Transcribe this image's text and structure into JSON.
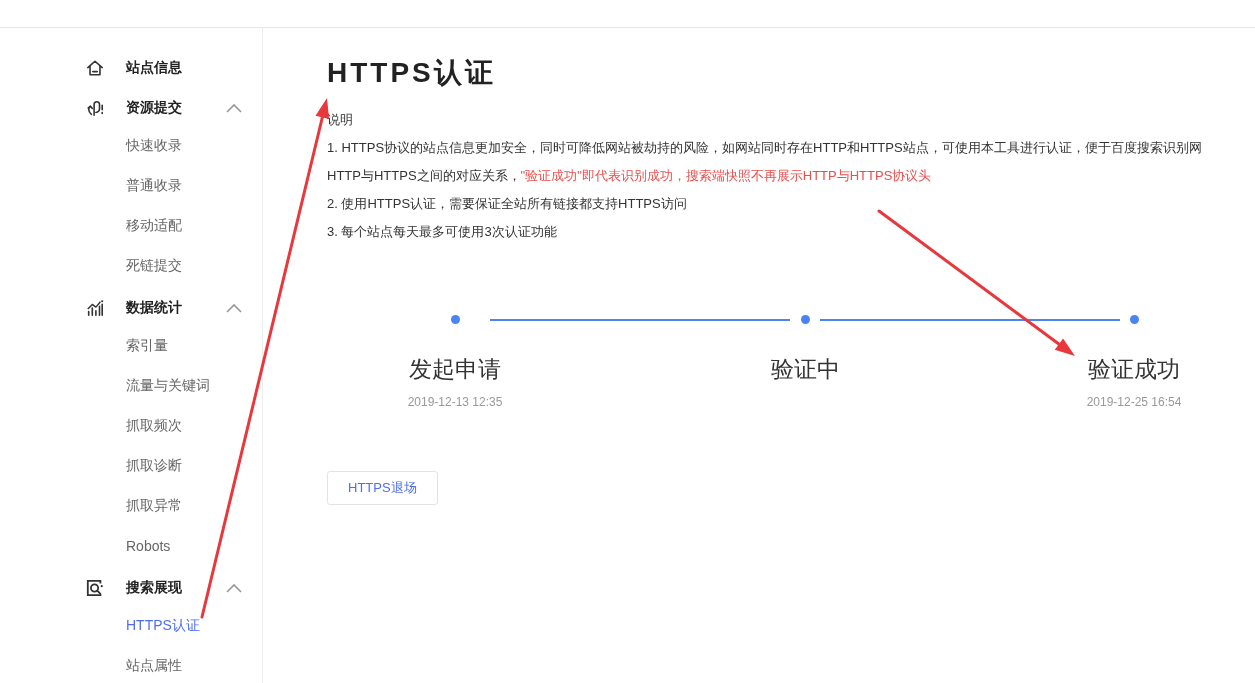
{
  "sidebar": {
    "top_item": {
      "label": "站点信息",
      "selected": false
    },
    "groups": [
      {
        "label": "资源提交",
        "expanded": true,
        "items": [
          {
            "label": "快速收录",
            "selected": false
          },
          {
            "label": "普通收录",
            "selected": false
          },
          {
            "label": "移动适配",
            "selected": false
          },
          {
            "label": "死链提交",
            "selected": false
          }
        ]
      },
      {
        "label": "数据统计",
        "expanded": true,
        "items": [
          {
            "label": "索引量",
            "selected": false
          },
          {
            "label": "流量与关键词",
            "selected": false
          },
          {
            "label": "抓取频次",
            "selected": false
          },
          {
            "label": "抓取诊断",
            "selected": false
          },
          {
            "label": "抓取异常",
            "selected": false
          },
          {
            "label": "Robots",
            "selected": false
          }
        ]
      },
      {
        "label": "搜索展现",
        "expanded": true,
        "items": [
          {
            "label": "HTTPS认证",
            "selected": true
          },
          {
            "label": "站点属性",
            "selected": false
          }
        ]
      }
    ]
  },
  "title": "HTTPS认证",
  "notes": {
    "heading": "说明",
    "lines": [
      {
        "text": "1. HTTPS协议的站点信息更加安全，同时可降低网站被劫持的风险，如网站同时存在HTTP和HTTPS站点，可使用本工具进行认证，便于百度搜索识别网"
      },
      {
        "text": "HTTP与HTTPS之间的对应关系，",
        "highlight": "\"验证成功\"即代表识别成功，搜索端快照不再展示HTTP与HTTPS协议头"
      },
      {
        "text": "2. 使用HTTPS认证，需要保证全站所有链接都支持HTTPS访问"
      },
      {
        "text": "3. 每个站点每天最多可使用3次认证功能"
      }
    ]
  },
  "steps": [
    {
      "label": "发起申请",
      "time": "2019-12-13 12:35",
      "done": true
    },
    {
      "label": "验证中",
      "done": true
    },
    {
      "label": "验证成功",
      "time": "2019-12-25 16:54",
      "done": true
    }
  ],
  "button": {
    "label": "HTTPS退场"
  },
  "annotations": [
    {
      "kind": "arrow"
    },
    {
      "kind": "arrow"
    }
  ]
}
